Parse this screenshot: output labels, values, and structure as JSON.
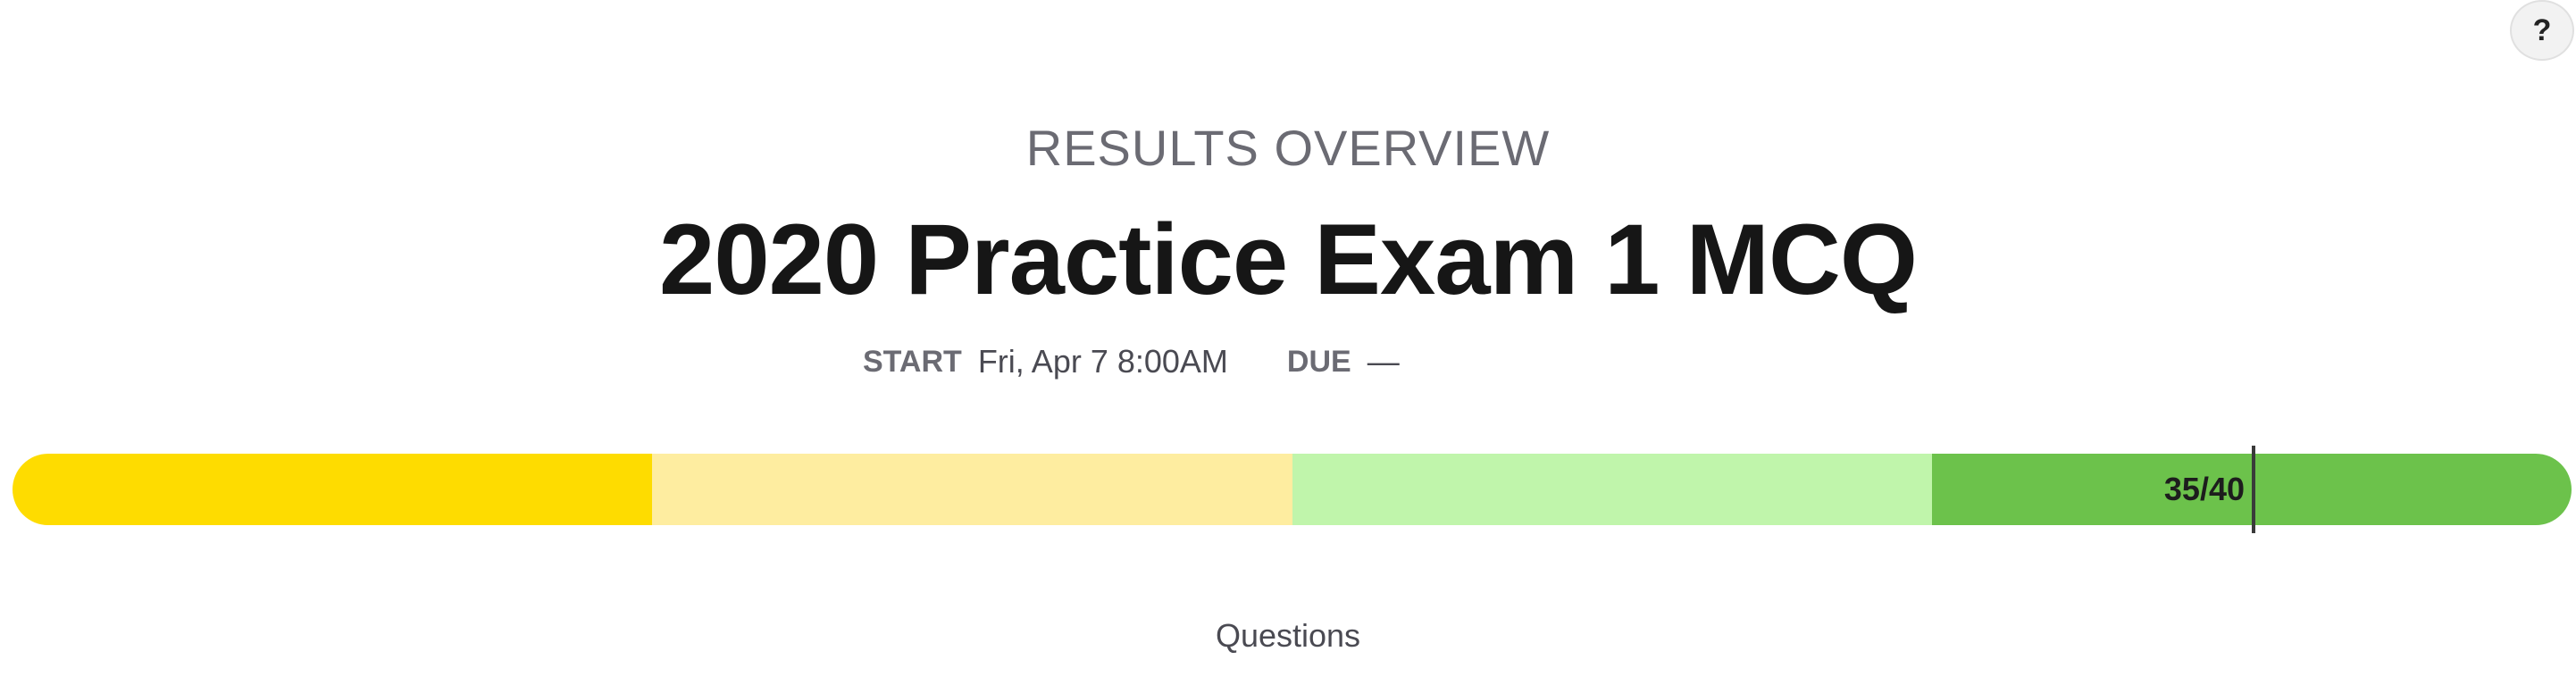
{
  "help": {
    "label": "?"
  },
  "header": {
    "eyebrow": "RESULTS OVERVIEW",
    "title": "2020 Practice Exam 1 MCQ"
  },
  "meta": {
    "start_label": "START",
    "start_value": "Fri, Apr 7 8:00AM",
    "due_label": "DUE",
    "due_value": "—"
  },
  "score_bar": {
    "score_text": "35/40",
    "score": 35,
    "total": 40,
    "segments": [
      {
        "color": "#fedc00"
      },
      {
        "color": "#feeda0"
      },
      {
        "color": "#c0f5ab"
      },
      {
        "color": "#6cc24b"
      }
    ]
  },
  "section": {
    "heading": "Questions"
  }
}
